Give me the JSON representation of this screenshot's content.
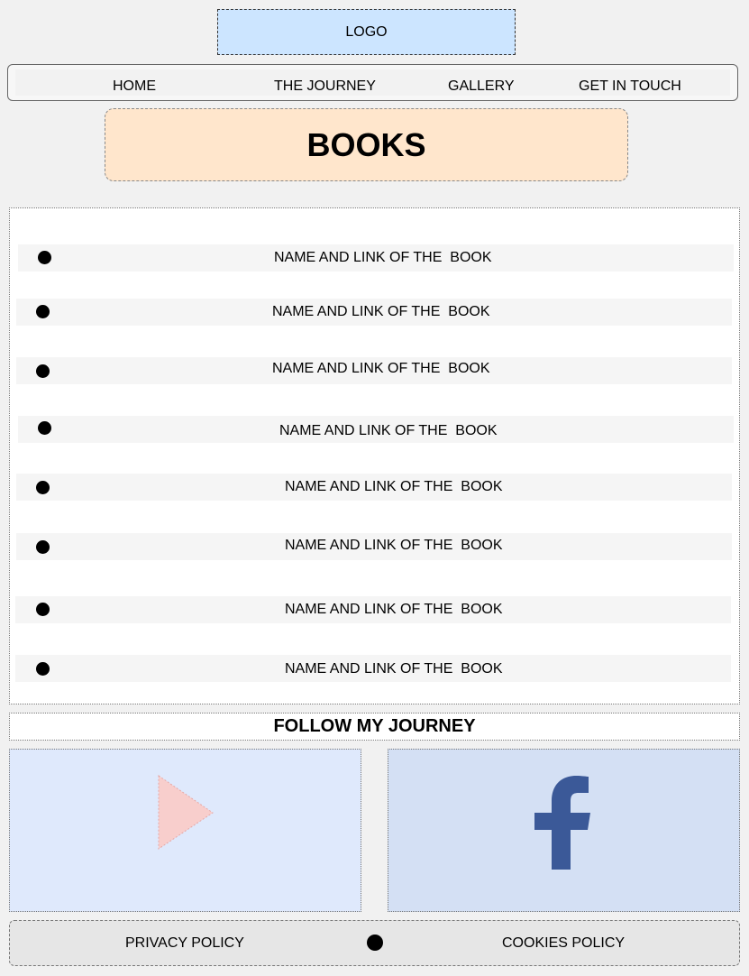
{
  "header": {
    "logo_text": "LOGO"
  },
  "nav": {
    "items": [
      {
        "label": "HOME"
      },
      {
        "label": "THE JOURNEY"
      },
      {
        "label": "GALLERY"
      },
      {
        "label": "GET IN TOUCH"
      }
    ]
  },
  "page": {
    "title": "BOOKS"
  },
  "books": {
    "items": [
      {
        "label": "NAME AND LINK OF THE  BOOK"
      },
      {
        "label": "NAME AND LINK OF THE  BOOK"
      },
      {
        "label": "NAME AND LINK OF THE  BOOK"
      },
      {
        "label": "NAME AND LINK OF THE  BOOK"
      },
      {
        "label": "NAME AND LINK OF THE  BOOK"
      },
      {
        "label": "NAME AND LINK OF THE  BOOK"
      },
      {
        "label": "NAME AND LINK OF THE  BOOK"
      },
      {
        "label": "NAME AND LINK OF THE  BOOK"
      }
    ]
  },
  "follow": {
    "heading": "FOLLOW MY JOURNEY",
    "tiles": [
      {
        "icon": "youtube-play-icon",
        "color": "#f8cecc"
      },
      {
        "icon": "facebook-icon",
        "color": "#3b5998"
      }
    ]
  },
  "footer": {
    "privacy_label": "PRIVACY POLICY",
    "cookies_label": "COOKIES POLICY"
  },
  "colors": {
    "logo_bg": "#cce5ff",
    "title_bg": "#ffe6cc",
    "youtube_tile_bg": "#dfe9fc",
    "facebook_tile_bg": "#d4e0f4"
  }
}
